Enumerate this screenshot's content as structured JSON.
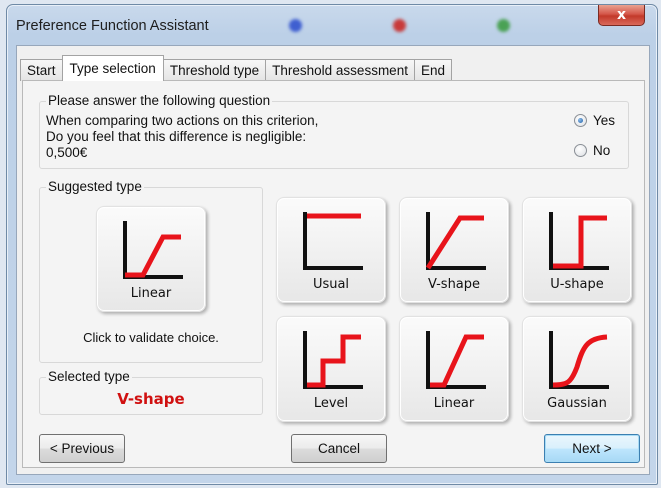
{
  "window": {
    "title": "Preference Function Assistant",
    "close_label": "x"
  },
  "tabs": [
    {
      "label": "Start",
      "active": false
    },
    {
      "label": "Type selection",
      "active": true
    },
    {
      "label": "Threshold type",
      "active": false
    },
    {
      "label": "Threshold assessment",
      "active": false
    },
    {
      "label": "End",
      "active": false
    }
  ],
  "question": {
    "legend": "Please answer the following question",
    "line1": "When comparing two actions on this criterion,",
    "line2": "Do you feel that this difference is negligible:",
    "line3": "0,500€",
    "options": [
      {
        "label": "Yes",
        "selected": true
      },
      {
        "label": "No",
        "selected": false
      }
    ]
  },
  "suggested": {
    "legend": "Suggested type",
    "button_label": "Linear",
    "hint": "Click to validate choice."
  },
  "selected": {
    "legend": "Selected type",
    "value": "V-shape"
  },
  "types": [
    {
      "label": "Usual",
      "icon": "usual-curve-icon"
    },
    {
      "label": "V-shape",
      "icon": "v-shape-curve-icon"
    },
    {
      "label": "U-shape",
      "icon": "u-shape-curve-icon"
    },
    {
      "label": "Level",
      "icon": "level-curve-icon"
    },
    {
      "label": "Linear",
      "icon": "linear-curve-icon"
    },
    {
      "label": "Gaussian",
      "icon": "gaussian-curve-icon"
    }
  ],
  "footer": {
    "previous": "< Previous",
    "cancel": "Cancel",
    "next": "Next >"
  },
  "colors": {
    "curve": "#e8141b",
    "axis": "#111111",
    "selected_text": "#d01010"
  }
}
